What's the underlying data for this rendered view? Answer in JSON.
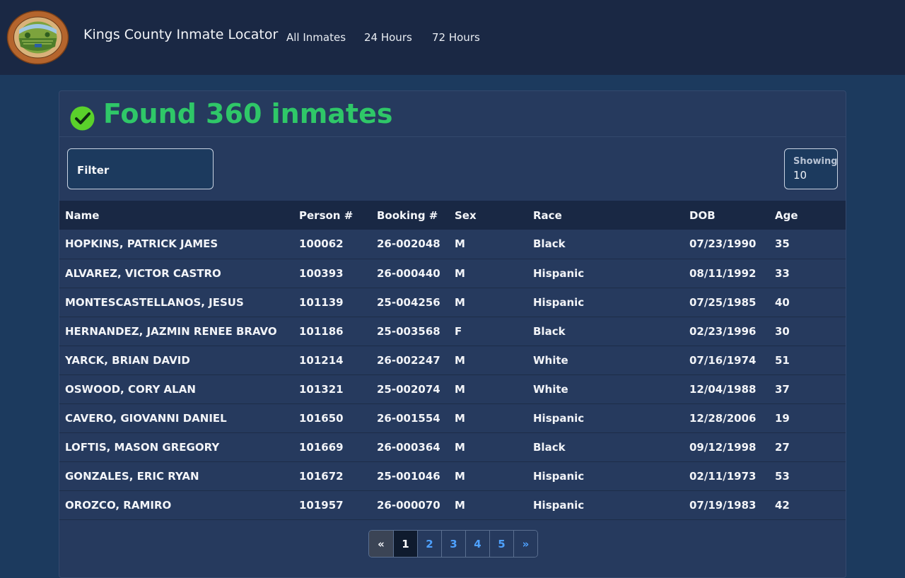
{
  "nav": {
    "brand": "Kings County Inmate Locator",
    "links": [
      "All Inmates",
      "24 Hours",
      "72 Hours"
    ]
  },
  "colors": {
    "navbar": "#1a2844",
    "background": "#1c3a5e",
    "card": "#263a5e",
    "success": "#2fc768",
    "link": "#4ea1ff"
  },
  "result": {
    "text": "Found 360 inmates",
    "icon": "check-circle-icon"
  },
  "filter": {
    "label": "Filter"
  },
  "showing": {
    "label": "Showing",
    "value": "10"
  },
  "table": {
    "headers": [
      "Name",
      "Person #",
      "Booking #",
      "Sex",
      "Race",
      "DOB",
      "Age"
    ],
    "rows": [
      [
        "HOPKINS, PATRICK JAMES",
        "100062",
        "26-002048",
        "M",
        "Black",
        "07/23/1990",
        "35"
      ],
      [
        "ALVAREZ, VICTOR CASTRO",
        "100393",
        "26-000440",
        "M",
        "Hispanic",
        "08/11/1992",
        "33"
      ],
      [
        "MONTESCASTELLANOS, JESUS",
        "101139",
        "25-004256",
        "M",
        "Hispanic",
        "07/25/1985",
        "40"
      ],
      [
        "HERNANDEZ, JAZMIN RENEE BRAVO",
        "101186",
        "25-003568",
        "F",
        "Black",
        "02/23/1996",
        "30"
      ],
      [
        "YARCK, BRIAN DAVID",
        "101214",
        "26-002247",
        "M",
        "White",
        "07/16/1974",
        "51"
      ],
      [
        "OSWOOD, CORY ALAN",
        "101321",
        "25-002074",
        "M",
        "White",
        "12/04/1988",
        "37"
      ],
      [
        "CAVERO, GIOVANNI DANIEL",
        "101650",
        "26-001554",
        "M",
        "Hispanic",
        "12/28/2006",
        "19"
      ],
      [
        "LOFTIS, MASON GREGORY",
        "101669",
        "26-000364",
        "M",
        "Black",
        "09/12/1998",
        "27"
      ],
      [
        "GONZALES, ERIC RYAN",
        "101672",
        "25-001046",
        "M",
        "Hispanic",
        "02/11/1973",
        "53"
      ],
      [
        "OROZCO, RAMIRO",
        "101957",
        "26-000070",
        "M",
        "Hispanic",
        "07/19/1983",
        "42"
      ]
    ]
  },
  "pagination": {
    "prev": "«",
    "pages": [
      "1",
      "2",
      "3",
      "4",
      "5"
    ],
    "next": "»",
    "current": "1"
  }
}
